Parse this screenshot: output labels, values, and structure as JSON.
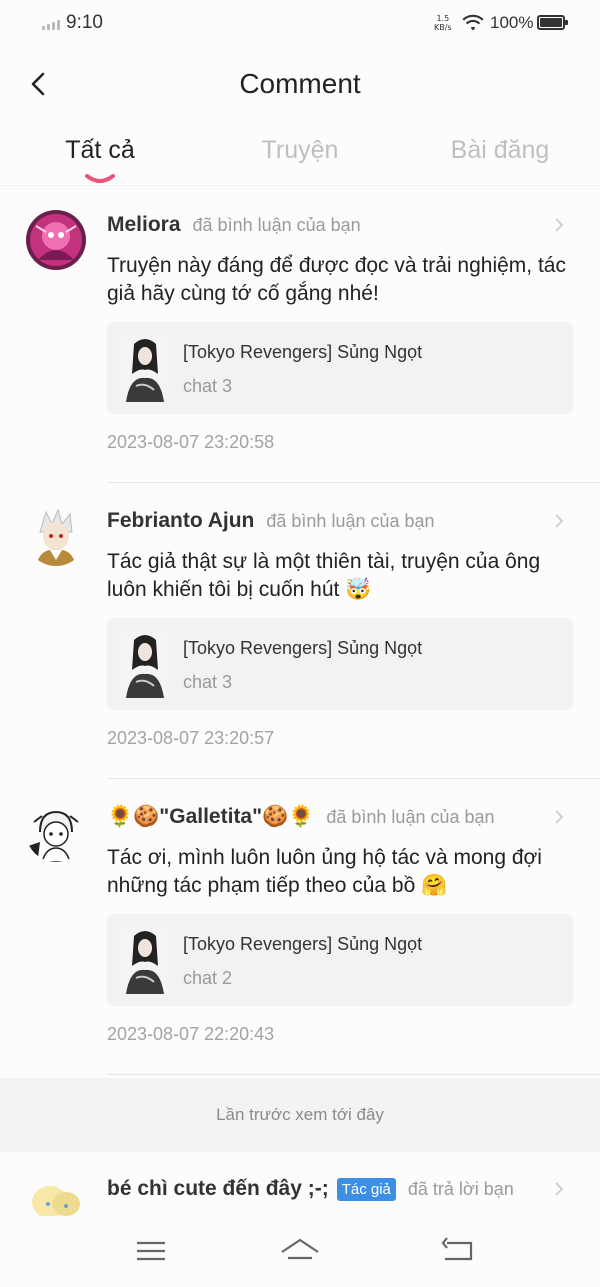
{
  "status_bar": {
    "time": "9:10",
    "net_speed_value": "1.5",
    "net_speed_unit": "KB/s",
    "battery": "100%"
  },
  "header": {
    "title": "Comment",
    "back_icon": "chevron-left-icon"
  },
  "tabs": [
    {
      "label": "Tất cả",
      "active": true
    },
    {
      "label": "Truyện",
      "active": false
    },
    {
      "label": "Bài đăng",
      "active": false
    }
  ],
  "colors": {
    "tab_underline": "#e8557a",
    "author_badge": "#3d8fe6",
    "muted_text": "#9a9a9a"
  },
  "comments": [
    {
      "name": "Meliora",
      "action": "đã bình luận của bạn",
      "text": "Truyện này đáng để được đọc và trải nghiệm, tác giả hãy cùng tớ cố gắng nhé!",
      "story_title": "[Tokyo Revengers] Sủng Ngọt",
      "chapter": "chat 3",
      "time": "2023-08-07 23:20:58"
    },
    {
      "name": "Febrianto Ajun",
      "action": "đã bình luận của bạn",
      "text": "Tác giả thật sự là một thiên tài, truyện của ông luôn khiến tôi bị cuốn hút 🤯",
      "story_title": "[Tokyo Revengers] Sủng Ngọt",
      "chapter": "chat 3",
      "time": "2023-08-07 23:20:57"
    },
    {
      "name": "🌻🍪\"Galletita\"🍪🌻",
      "action": "đã bình luận của bạn",
      "text": "Tác ơi, mình luôn luôn ủng hộ tác và mong đợi những tác phạm tiếp theo của bồ 🤗",
      "story_title": "[Tokyo Revengers] Sủng Ngọt",
      "chapter": "chat 2",
      "time": "2023-08-07 22:20:43"
    }
  ],
  "last_seen_label": "Lần trước xem tới đây",
  "reply": {
    "name": "bé chì cute đến đây ;-;",
    "badge": "Tác giả",
    "action": "đã trả lời bạn"
  },
  "nav_bar": {
    "icons": [
      "menu-icon",
      "home-icon",
      "back-icon"
    ]
  }
}
